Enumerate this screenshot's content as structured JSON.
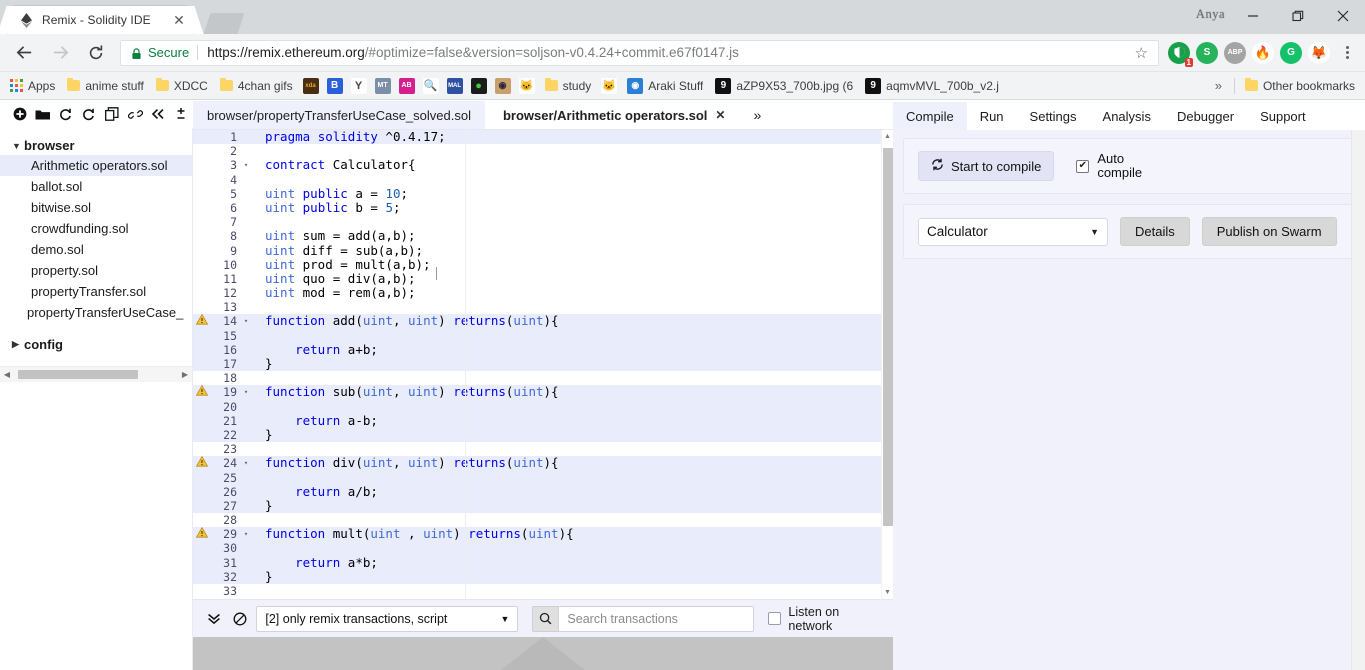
{
  "browser": {
    "tab": {
      "title": "Remix - Solidity IDE",
      "favicon": "ethereum-icon",
      "close_label": "✕"
    },
    "user": "Anya",
    "window_controls": {
      "minimize": "—",
      "maximize": "❐",
      "close": "✕"
    },
    "nav": {
      "back": "←",
      "forward": "→",
      "reload": "⟳"
    },
    "omnibox": {
      "security_label": "Secure",
      "url_base": "https://remix.ethereum.org",
      "url_rest": "/#optimize=false&version=soljson-v0.4.24+commit.e67f0147.js",
      "star": "☆"
    },
    "extensions": [
      {
        "name": "adguard-icon",
        "glyph": "",
        "color": "#18a04a",
        "badge": "1"
      },
      {
        "name": "s-extension-icon",
        "glyph": "S",
        "color": "#e03a28",
        "badge": ""
      },
      {
        "name": "adblock-plus-icon",
        "glyph": "ABP",
        "color": "#a4a4a4",
        "badge": ""
      },
      {
        "name": "flame-extension-icon",
        "glyph": "🔥",
        "color": "#ffffff",
        "badge": ""
      },
      {
        "name": "grammarly-icon",
        "glyph": "G",
        "color": "#15c26b",
        "badge": ""
      },
      {
        "name": "metamask-fox-icon",
        "glyph": "🦊",
        "color": "#ffffff",
        "badge": ""
      }
    ],
    "bookmarks": [
      {
        "name": "apps",
        "label": "Apps",
        "icon": "apps-grid-icon"
      },
      {
        "name": "anime-stuff",
        "label": "anime stuff",
        "icon": "folder-icon"
      },
      {
        "name": "xdcc",
        "label": "XDCC",
        "icon": "folder-icon"
      },
      {
        "name": "4chan-gifs",
        "label": "4chan gifs",
        "icon": "folder-icon"
      },
      {
        "name": "xda",
        "label": "",
        "icon": "xda-icon",
        "glyph": "xda",
        "color": "#4a2e12"
      },
      {
        "name": "b-site",
        "label": "",
        "icon": "b-icon",
        "glyph": "B",
        "color": "#2b5fd9"
      },
      {
        "name": "yi-site",
        "label": "",
        "icon": "y-icon",
        "glyph": "Y",
        "color": "#ffffff"
      },
      {
        "name": "mt-site",
        "label": "",
        "icon": "mt-icon",
        "glyph": "MT",
        "color": "#7b8fa8"
      },
      {
        "name": "ab-site",
        "label": "",
        "icon": "ab-icon",
        "glyph": "AB",
        "color": "#d61f8f"
      },
      {
        "name": "search-site",
        "label": "",
        "icon": "magnifier-icon",
        "glyph": "🔍",
        "color": "#ffffff"
      },
      {
        "name": "mal-site",
        "label": "",
        "icon": "mal-icon",
        "glyph": "MAL",
        "color": "#2e51a2"
      },
      {
        "name": "green-dot-site",
        "label": "",
        "icon": "green-circle-icon",
        "glyph": "●",
        "color": "#1b1b1b"
      },
      {
        "name": "eye-site",
        "label": "",
        "icon": "eye-icon",
        "glyph": "◉",
        "color": "#c9a06a"
      },
      {
        "name": "cat-site",
        "label": "",
        "icon": "cat-icon",
        "glyph": "🐱",
        "color": "#ffffff"
      },
      {
        "name": "study",
        "label": "study",
        "icon": "folder-icon"
      },
      {
        "name": "cat2-site",
        "label": "",
        "icon": "cat-icon",
        "glyph": "🐱",
        "color": "#ffffff"
      },
      {
        "name": "araki-stuff",
        "label": "Araki Stuff",
        "icon": "blue-circle-icon",
        "glyph": "◉",
        "color": "#2b7fd6"
      },
      {
        "name": "azp9x53",
        "label": "aZP9X53_700b.jpg (6",
        "icon": "image-host-icon",
        "glyph": "9",
        "color": "#101010"
      },
      {
        "name": "aqmvmvl",
        "label": "aqmvMVL_700b_v2.j",
        "icon": "image-host-icon",
        "glyph": "9",
        "color": "#101010"
      }
    ],
    "bookmarks_overflow": "»",
    "other_bookmarks": "Other bookmarks"
  },
  "ide": {
    "toolbar_icons": [
      {
        "name": "create-file-icon",
        "glyph": "✚"
      },
      {
        "name": "open-folder-icon",
        "glyph": "🗁"
      },
      {
        "name": "publish-gist-icon",
        "glyph": "⟳"
      },
      {
        "name": "copy-gist-icon",
        "glyph": "⟲"
      },
      {
        "name": "copy-files-icon",
        "glyph": "⧉"
      },
      {
        "name": "connect-localhost-icon",
        "glyph": "🔗"
      },
      {
        "name": "collapse-panel-icon",
        "glyph": "«"
      },
      {
        "name": "font-size-icon",
        "glyph": "±"
      }
    ],
    "file_tabs": [
      {
        "name": "tab-property-transfer-usecase-solved",
        "label": "browser/propertyTransferUseCase_solved.sol",
        "active": false,
        "closable": false
      },
      {
        "name": "tab-arithmetic-operators",
        "label": "browser/Arithmetic operators.sol",
        "active": true,
        "closable": true,
        "close_glyph": "✕"
      }
    ],
    "file_tabs_more": "»",
    "file_explorer": {
      "roots": [
        {
          "name": "browser",
          "label": "browser",
          "expanded": true,
          "caret": "▼",
          "files": [
            {
              "label": "Arithmetic operators.sol",
              "selected": true
            },
            {
              "label": "ballot.sol",
              "selected": false
            },
            {
              "label": "bitwise.sol",
              "selected": false
            },
            {
              "label": "crowdfunding.sol",
              "selected": false
            },
            {
              "label": "demo.sol",
              "selected": false
            },
            {
              "label": "property.sol",
              "selected": false
            },
            {
              "label": "propertyTransfer.sol",
              "selected": false
            },
            {
              "label": "propertyTransferUseCase_",
              "selected": false
            }
          ]
        },
        {
          "name": "config",
          "label": "config",
          "expanded": false,
          "caret": "▶",
          "files": []
        }
      ],
      "hscroll": {
        "left_arrow": "◀",
        "right_arrow": "▶"
      }
    },
    "editor": {
      "lines": [
        {
          "n": 1,
          "warn": false,
          "fold": "",
          "hl": true,
          "tokens": [
            {
              "t": "k",
              "v": "pragma"
            },
            {
              "t": "p",
              "v": " "
            },
            {
              "t": "k",
              "v": "solidity"
            },
            {
              "t": "p",
              "v": " ^0.4.17;"
            }
          ]
        },
        {
          "n": 2,
          "warn": false,
          "fold": "",
          "hl": false,
          "tokens": []
        },
        {
          "n": 3,
          "warn": false,
          "fold": "▾",
          "hl": false,
          "tokens": [
            {
              "t": "k",
              "v": "contract"
            },
            {
              "t": "p",
              "v": " Calculator{"
            }
          ]
        },
        {
          "n": 4,
          "warn": false,
          "fold": "",
          "hl": false,
          "tokens": []
        },
        {
          "n": 5,
          "warn": false,
          "fold": "",
          "hl": false,
          "tokens": [
            {
              "t": "t",
              "v": "uint"
            },
            {
              "t": "p",
              "v": " "
            },
            {
              "t": "k",
              "v": "public"
            },
            {
              "t": "p",
              "v": " a = "
            },
            {
              "t": "n",
              "v": "10"
            },
            {
              "t": "p",
              "v": ";"
            }
          ]
        },
        {
          "n": 6,
          "warn": false,
          "fold": "",
          "hl": false,
          "tokens": [
            {
              "t": "t",
              "v": "uint"
            },
            {
              "t": "p",
              "v": " "
            },
            {
              "t": "k",
              "v": "public"
            },
            {
              "t": "p",
              "v": " b = "
            },
            {
              "t": "n",
              "v": "5"
            },
            {
              "t": "p",
              "v": ";"
            }
          ]
        },
        {
          "n": 7,
          "warn": false,
          "fold": "",
          "hl": false,
          "tokens": []
        },
        {
          "n": 8,
          "warn": false,
          "fold": "",
          "hl": false,
          "tokens": [
            {
              "t": "t",
              "v": "uint"
            },
            {
              "t": "p",
              "v": " sum = add(a,b);"
            }
          ]
        },
        {
          "n": 9,
          "warn": false,
          "fold": "",
          "hl": false,
          "tokens": [
            {
              "t": "t",
              "v": "uint"
            },
            {
              "t": "p",
              "v": " diff = sub(a,b);"
            }
          ]
        },
        {
          "n": 10,
          "warn": false,
          "fold": "",
          "hl": false,
          "tokens": [
            {
              "t": "t",
              "v": "uint"
            },
            {
              "t": "p",
              "v": " prod = mult(a,b);"
            }
          ]
        },
        {
          "n": 11,
          "warn": false,
          "fold": "",
          "hl": false,
          "tokens": [
            {
              "t": "t",
              "v": "uint"
            },
            {
              "t": "p",
              "v": " quo = div(a,b);"
            }
          ]
        },
        {
          "n": 12,
          "warn": false,
          "fold": "",
          "hl": false,
          "tokens": [
            {
              "t": "t",
              "v": "uint"
            },
            {
              "t": "p",
              "v": " mod = rem(a,b);"
            }
          ]
        },
        {
          "n": 13,
          "warn": false,
          "fold": "",
          "hl": false,
          "tokens": []
        },
        {
          "n": 14,
          "warn": true,
          "fold": "▾",
          "hl": true,
          "tokens": [
            {
              "t": "k",
              "v": "function"
            },
            {
              "t": "p",
              "v": " add("
            },
            {
              "t": "t",
              "v": "uint"
            },
            {
              "t": "p",
              "v": ", "
            },
            {
              "t": "t",
              "v": "uint"
            },
            {
              "t": "p",
              "v": ") "
            },
            {
              "t": "k",
              "v": "returns"
            },
            {
              "t": "p",
              "v": "("
            },
            {
              "t": "t",
              "v": "uint"
            },
            {
              "t": "p",
              "v": "){"
            }
          ]
        },
        {
          "n": 15,
          "warn": false,
          "fold": "",
          "hl": true,
          "tokens": []
        },
        {
          "n": 16,
          "warn": false,
          "fold": "",
          "hl": true,
          "tokens": [
            {
              "t": "p",
              "v": "    "
            },
            {
              "t": "k",
              "v": "return"
            },
            {
              "t": "p",
              "v": " a+b;"
            }
          ]
        },
        {
          "n": 17,
          "warn": false,
          "fold": "",
          "hl": true,
          "tokens": [
            {
              "t": "p",
              "v": "}"
            }
          ]
        },
        {
          "n": 18,
          "warn": false,
          "fold": "",
          "hl": false,
          "tokens": []
        },
        {
          "n": 19,
          "warn": true,
          "fold": "▾",
          "hl": true,
          "tokens": [
            {
              "t": "k",
              "v": "function"
            },
            {
              "t": "p",
              "v": " sub("
            },
            {
              "t": "t",
              "v": "uint"
            },
            {
              "t": "p",
              "v": ", "
            },
            {
              "t": "t",
              "v": "uint"
            },
            {
              "t": "p",
              "v": ") "
            },
            {
              "t": "k",
              "v": "returns"
            },
            {
              "t": "p",
              "v": "("
            },
            {
              "t": "t",
              "v": "uint"
            },
            {
              "t": "p",
              "v": "){"
            }
          ]
        },
        {
          "n": 20,
          "warn": false,
          "fold": "",
          "hl": true,
          "tokens": []
        },
        {
          "n": 21,
          "warn": false,
          "fold": "",
          "hl": true,
          "tokens": [
            {
              "t": "p",
              "v": "    "
            },
            {
              "t": "k",
              "v": "return"
            },
            {
              "t": "p",
              "v": " a-b;"
            }
          ]
        },
        {
          "n": 22,
          "warn": false,
          "fold": "",
          "hl": true,
          "tokens": [
            {
              "t": "p",
              "v": "}"
            }
          ]
        },
        {
          "n": 23,
          "warn": false,
          "fold": "",
          "hl": false,
          "tokens": []
        },
        {
          "n": 24,
          "warn": true,
          "fold": "▾",
          "hl": true,
          "tokens": [
            {
              "t": "k",
              "v": "function"
            },
            {
              "t": "p",
              "v": " div("
            },
            {
              "t": "t",
              "v": "uint"
            },
            {
              "t": "p",
              "v": ", "
            },
            {
              "t": "t",
              "v": "uint"
            },
            {
              "t": "p",
              "v": ") "
            },
            {
              "t": "k",
              "v": "returns"
            },
            {
              "t": "p",
              "v": "("
            },
            {
              "t": "t",
              "v": "uint"
            },
            {
              "t": "p",
              "v": "){"
            }
          ]
        },
        {
          "n": 25,
          "warn": false,
          "fold": "",
          "hl": true,
          "tokens": []
        },
        {
          "n": 26,
          "warn": false,
          "fold": "",
          "hl": true,
          "tokens": [
            {
              "t": "p",
              "v": "    "
            },
            {
              "t": "k",
              "v": "return"
            },
            {
              "t": "p",
              "v": " a/b;"
            }
          ]
        },
        {
          "n": 27,
          "warn": false,
          "fold": "",
          "hl": true,
          "tokens": [
            {
              "t": "p",
              "v": "}"
            }
          ]
        },
        {
          "n": 28,
          "warn": false,
          "fold": "",
          "hl": false,
          "tokens": []
        },
        {
          "n": 29,
          "warn": true,
          "fold": "▾",
          "hl": true,
          "tokens": [
            {
              "t": "k",
              "v": "function"
            },
            {
              "t": "p",
              "v": " mult("
            },
            {
              "t": "t",
              "v": "uint"
            },
            {
              "t": "p",
              "v": " , "
            },
            {
              "t": "t",
              "v": "uint"
            },
            {
              "t": "p",
              "v": ") "
            },
            {
              "t": "k",
              "v": "returns"
            },
            {
              "t": "p",
              "v": "("
            },
            {
              "t": "t",
              "v": "uint"
            },
            {
              "t": "p",
              "v": "){"
            }
          ]
        },
        {
          "n": 30,
          "warn": false,
          "fold": "",
          "hl": true,
          "tokens": []
        },
        {
          "n": 31,
          "warn": false,
          "fold": "",
          "hl": true,
          "tokens": [
            {
              "t": "p",
              "v": "    "
            },
            {
              "t": "k",
              "v": "return"
            },
            {
              "t": "p",
              "v": " a*b;"
            }
          ]
        },
        {
          "n": 32,
          "warn": false,
          "fold": "",
          "hl": true,
          "tokens": [
            {
              "t": "p",
              "v": "}"
            }
          ]
        },
        {
          "n": 33,
          "warn": false,
          "fold": "",
          "hl": false,
          "tokens": []
        }
      ],
      "warning_glyph": "⚠",
      "scroll": {
        "up": "▲",
        "down": "▼"
      }
    },
    "right_panel": {
      "tabs": [
        {
          "name": "tab-compile",
          "label": "Compile",
          "active": true
        },
        {
          "name": "tab-run",
          "label": "Run",
          "active": false
        },
        {
          "name": "tab-settings",
          "label": "Settings",
          "active": false
        },
        {
          "name": "tab-analysis",
          "label": "Analysis",
          "active": false
        },
        {
          "name": "tab-debugger",
          "label": "Debugger",
          "active": false
        },
        {
          "name": "tab-support",
          "label": "Support",
          "active": false
        }
      ],
      "compile": {
        "start_button": "Start to compile",
        "start_icon": "refresh-icon",
        "auto_compile_label": "Auto compile",
        "auto_compile_checked": true,
        "contract_select": "Calculator",
        "contract_caret": "▼",
        "details_button": "Details",
        "publish_button": "Publish on Swarm"
      }
    },
    "terminal": {
      "toggle_icon": "chevron-double-down-icon",
      "toggle_glyph": "⌄",
      "clear_icon": "ban-icon",
      "clear_glyph": "⊘",
      "filter_select": "[2] only remix transactions, script",
      "filter_caret": "▼",
      "search_icon": "search-icon",
      "search_glyph": "Q",
      "search_placeholder": "Search transactions",
      "search_value": "",
      "listen_label": "Listen on network",
      "listen_checked": false
    }
  }
}
